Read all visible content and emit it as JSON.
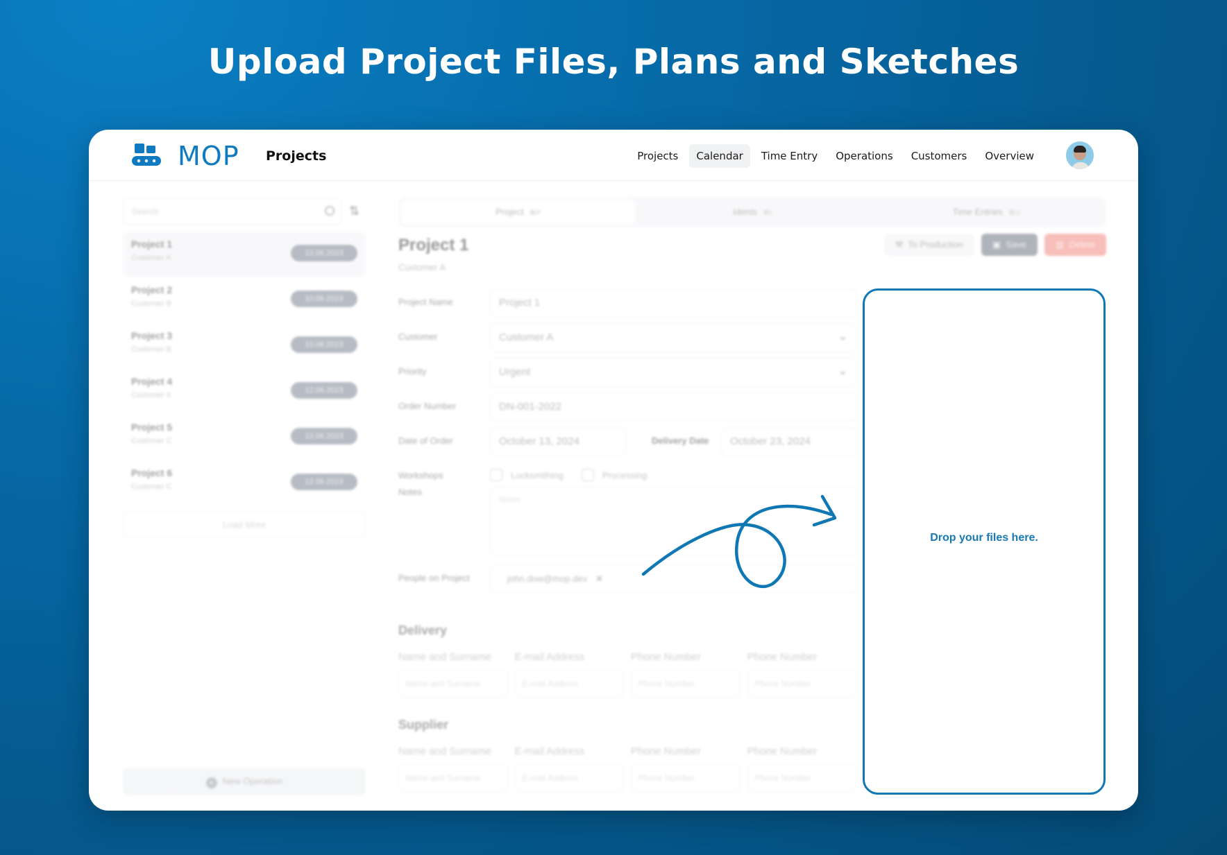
{
  "headline": "Upload Project Files, Plans and Sketches",
  "colors": {
    "accent": "#0f78b4",
    "brand": "#0f7ac0",
    "save": "#6f7784",
    "delete": "#f38980",
    "date_pill": "#7d8795"
  },
  "header": {
    "brand": "MOP",
    "app_title": "Projects",
    "nav": [
      {
        "label": "Projects",
        "active": false
      },
      {
        "label": "Calendar",
        "active": true
      },
      {
        "label": "Time Entry",
        "active": false
      },
      {
        "label": "Operations",
        "active": false
      },
      {
        "label": "Customers",
        "active": false
      },
      {
        "label": "Overview",
        "active": false
      }
    ],
    "avatar_icon": "user-avatar"
  },
  "sidebar": {
    "search_placeholder": "Search",
    "projects": [
      {
        "name": "Project 1",
        "customer": "Customer A",
        "date": "12.06.2023",
        "selected": true
      },
      {
        "name": "Project 2",
        "customer": "Customer B",
        "date": "10.06.2023",
        "selected": false
      },
      {
        "name": "Project 3",
        "customer": "Customer B",
        "date": "10.06.2023",
        "selected": false
      },
      {
        "name": "Project 4",
        "customer": "Customer 4",
        "date": "12.06.2023",
        "selected": false
      },
      {
        "name": "Project 5",
        "customer": "Customer C",
        "date": "12.06.2023",
        "selected": false
      },
      {
        "name": "Project 6",
        "customer": "Customer C",
        "date": "12.06.2023",
        "selected": false
      }
    ],
    "load_more": "Load More",
    "new_operation": "New Operation"
  },
  "main": {
    "tabs": [
      {
        "label": "Project",
        "shortcut": "⌘P",
        "active": true
      },
      {
        "label": "Idents",
        "shortcut": "⌘I",
        "active": false
      },
      {
        "label": "Time Entries",
        "shortcut": "⌘U",
        "active": false
      }
    ],
    "title": "Project 1",
    "subtitle": "Customer A",
    "actions": {
      "to_production": "To Production",
      "save": "Save",
      "delete": "Delete"
    },
    "form": {
      "project_name": {
        "label": "Project Name",
        "value": "Project 1"
      },
      "customer": {
        "label": "Customer",
        "value": "Customer A"
      },
      "priority": {
        "label": "Priority",
        "value": "Urgent"
      },
      "order_number": {
        "label": "Order Number",
        "value": "DN-001-2022"
      },
      "date_of_order": {
        "label": "Date of Order",
        "value": "October 13, 2024"
      },
      "delivery_date": {
        "label": "Delivery Date",
        "value": "October 23, 2024"
      },
      "workshops": {
        "label": "Workshops",
        "options": [
          {
            "label": "Locksmithing",
            "checked": false
          },
          {
            "label": "Processing",
            "checked": false
          }
        ]
      },
      "notes": {
        "label": "Notes",
        "placeholder": "Notes"
      },
      "people": {
        "label": "People on Project",
        "chips": [
          "john.dow@mop.dev"
        ]
      }
    },
    "delivery": {
      "title": "Delivery",
      "columns": [
        {
          "label": "Name and Surname",
          "placeholder": "Name and Surname"
        },
        {
          "label": "E-mail Address",
          "placeholder": "E-mail Address"
        },
        {
          "label": "Phone Number",
          "placeholder": "Phone Number"
        },
        {
          "label": "Phone Number",
          "placeholder": "Phone Number"
        }
      ]
    },
    "supplier": {
      "title": "Supplier",
      "columns": [
        {
          "label": "Name and Surname",
          "placeholder": "Name and Surname"
        },
        {
          "label": "E-mail Address",
          "placeholder": "E-mail Address"
        },
        {
          "label": "Phone Number",
          "placeholder": "Phone Number"
        },
        {
          "label": "Phone Number",
          "placeholder": "Phone Number"
        }
      ]
    }
  },
  "dropzone": {
    "text": "Drop your files here."
  }
}
